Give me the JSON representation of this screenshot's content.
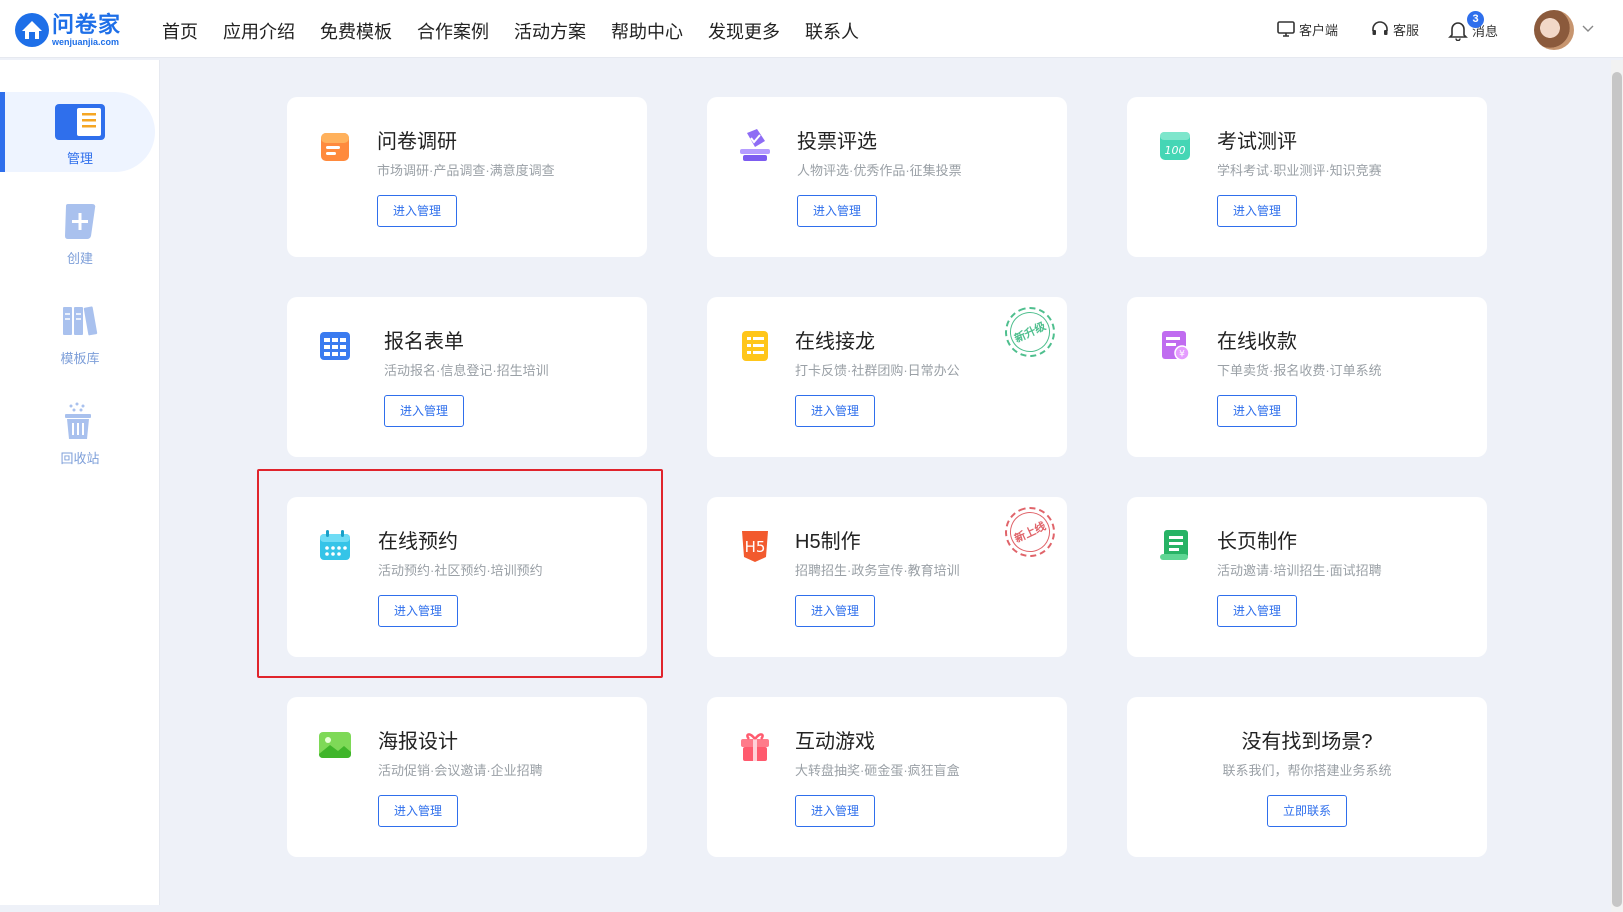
{
  "header": {
    "logo_cn": "问卷家",
    "logo_en": "wenjuanjia.com",
    "nav": [
      "首页",
      "应用介绍",
      "免费模板",
      "合作案例",
      "活动方案",
      "帮助中心",
      "发现更多",
      "联系人"
    ],
    "client_label": "客户端",
    "service_label": "客服",
    "message_label": "消息",
    "message_badge": "3"
  },
  "sidebar": {
    "items": [
      {
        "label": "管理",
        "active": true
      },
      {
        "label": "创建"
      },
      {
        "label": "模板库"
      },
      {
        "label": "回收站"
      }
    ]
  },
  "cards": [
    {
      "title": "问卷调研",
      "subtitle": "市场调研·产品调查·满意度调查",
      "button": "进入管理",
      "icon": "survey-icon"
    },
    {
      "title": "投票评选",
      "subtitle": "人物评选·优秀作品·征集投票",
      "button": "进入管理",
      "icon": "vote-icon"
    },
    {
      "title": "考试测评",
      "subtitle": "学科考试·职业测评·知识竞赛",
      "button": "进入管理",
      "icon": "exam-icon"
    },
    {
      "title": "报名表单",
      "subtitle": "活动报名·信息登记·招生培训",
      "button": "进入管理",
      "icon": "form-icon"
    },
    {
      "title": "在线接龙",
      "subtitle": "打卡反馈·社群团购·日常办公",
      "button": "进入管理",
      "icon": "relay-icon",
      "stamp": "新升级"
    },
    {
      "title": "在线收款",
      "subtitle": "下单卖货·报名收费·订单系统",
      "button": "进入管理",
      "icon": "payment-icon"
    },
    {
      "title": "在线预约",
      "subtitle": "活动预约·社区预约·培训预约",
      "button": "进入管理",
      "icon": "calendar-icon"
    },
    {
      "title": "H5制作",
      "subtitle": "招聘招生·政务宣传·教育培训",
      "button": "进入管理",
      "icon": "h5-icon",
      "stamp": "新上线"
    },
    {
      "title": "长页制作",
      "subtitle": "活动邀请·培训招生·面试招聘",
      "button": "进入管理",
      "icon": "longpage-icon"
    },
    {
      "title": "海报设计",
      "subtitle": "活动促销·会议邀请·企业招聘",
      "button": "进入管理",
      "icon": "poster-icon"
    },
    {
      "title": "互动游戏",
      "subtitle": "大转盘抽奖·砸金蛋·疯狂盲盒",
      "button": "进入管理",
      "icon": "gift-icon"
    },
    {
      "title": "没有找到场景?",
      "subtitle": "联系我们，帮你搭建业务系统",
      "button": "立即联系"
    }
  ]
}
